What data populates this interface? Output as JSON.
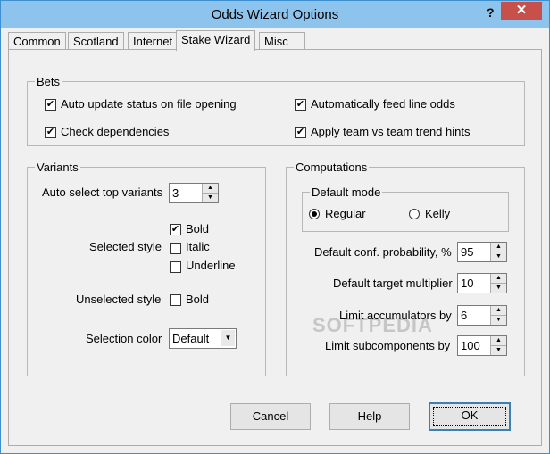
{
  "window": {
    "title": "Odds Wizard Options",
    "help_glyph": "?",
    "close_glyph": "✕"
  },
  "tabs": [
    {
      "label": "Common"
    },
    {
      "label": "Scotland"
    },
    {
      "label": "Internet"
    },
    {
      "label": "Stake Wizard"
    },
    {
      "label": "Misc"
    }
  ],
  "active_tab": "Stake Wizard",
  "bets": {
    "legend": "Bets",
    "auto_update": {
      "label": "Auto update status on file opening",
      "checked": true
    },
    "check_deps": {
      "label": "Check dependencies",
      "checked": true
    },
    "auto_feed": {
      "label": "Automatically feed line odds",
      "checked": true
    },
    "apply_trend": {
      "label": "Apply team vs team trend hints",
      "checked": true
    }
  },
  "variants": {
    "legend": "Variants",
    "auto_select_label": "Auto select top variants",
    "auto_select_value": "3",
    "selected_style_label": "Selected style",
    "bold": {
      "label": "Bold",
      "checked": true
    },
    "italic": {
      "label": "Italic",
      "checked": false
    },
    "underline": {
      "label": "Underline",
      "checked": false
    },
    "unselected_style_label": "Unselected style",
    "unselected_bold": {
      "label": "Bold",
      "checked": false
    },
    "selection_color_label": "Selection color",
    "selection_color_value": "Default"
  },
  "computations": {
    "legend": "Computations",
    "mode_legend": "Default mode",
    "regular_label": "Regular",
    "kelly_label": "Kelly",
    "mode_selected": "Regular",
    "conf_prob_label": "Default conf. probability, %",
    "conf_prob_value": "95",
    "target_mult_label": "Default target multiplier",
    "target_mult_value": "10",
    "limit_acc_label": "Limit accumulators by",
    "limit_acc_value": "6",
    "limit_sub_label": "Limit subcomponents by",
    "limit_sub_value": "100"
  },
  "buttons": {
    "cancel": "Cancel",
    "help": "Help",
    "ok": "OK"
  },
  "watermark": "SOFTPEDIA",
  "check_glyph": "✔",
  "up_glyph": "▲",
  "down_glyph": "▼"
}
